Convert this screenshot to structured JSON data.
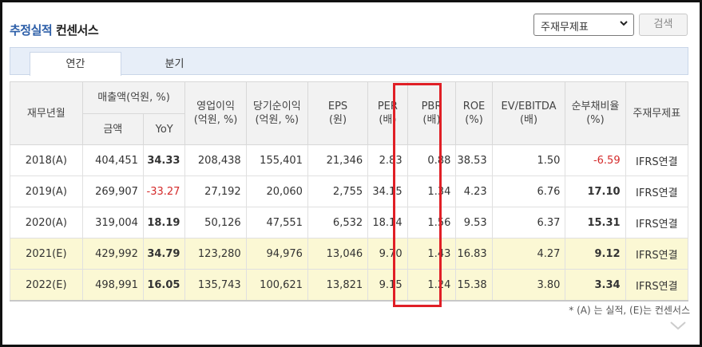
{
  "title": {
    "highlight": "추정실적",
    "rest": "컨센서스"
  },
  "select": {
    "value": "주재무제표"
  },
  "search_button": "검색",
  "tabs": [
    "연간",
    "분기"
  ],
  "header": {
    "year": "재무년월",
    "sales_group": "매출액(억원, %)",
    "sales_amount": "금액",
    "sales_yoy": "YoY",
    "op_profit": "영업이익\n(억원, %)",
    "net_profit": "당기순이익\n(억원, %)",
    "eps": "EPS\n(원)",
    "per": "PER\n(배)",
    "pbr": "PBR\n(배)",
    "roe": "ROE\n(%)",
    "ev": "EV/EBITDA\n(배)",
    "debt": "순부채비율\n(%)",
    "fs": "주재무제표"
  },
  "rows": [
    {
      "year": "2018(A)",
      "sales": "404,451",
      "yoy": "34.33",
      "op": "208,438",
      "net": "155,401",
      "eps": "21,346",
      "per": "2.83",
      "pbr": "0.88",
      "roe": "38.53",
      "ev": "1.50",
      "debt": "-6.59",
      "fs": "IFRS연결"
    },
    {
      "year": "2019(A)",
      "sales": "269,907",
      "yoy": "-33.27",
      "op": "27,192",
      "net": "20,060",
      "eps": "2,755",
      "per": "34.15",
      "pbr": "1.34",
      "roe": "4.23",
      "ev": "6.76",
      "debt": "17.10",
      "fs": "IFRS연결"
    },
    {
      "year": "2020(A)",
      "sales": "319,004",
      "yoy": "18.19",
      "op": "50,126",
      "net": "47,551",
      "eps": "6,532",
      "per": "18.14",
      "pbr": "1.56",
      "roe": "9.53",
      "ev": "6.37",
      "debt": "15.31",
      "fs": "IFRS연결"
    },
    {
      "year": "2021(E)",
      "sales": "429,992",
      "yoy": "34.79",
      "op": "123,280",
      "net": "94,976",
      "eps": "13,046",
      "per": "9.70",
      "pbr": "1.43",
      "roe": "16.83",
      "ev": "4.27",
      "debt": "9.12",
      "fs": "IFRS연결"
    },
    {
      "year": "2022(E)",
      "sales": "498,991",
      "yoy": "16.05",
      "op": "135,743",
      "net": "100,621",
      "eps": "13,821",
      "per": "9.15",
      "pbr": "1.24",
      "roe": "15.38",
      "ev": "3.80",
      "debt": "3.34",
      "fs": "IFRS연결"
    }
  ],
  "note": "* (A) 는 실적, (E)는 컨센서스"
}
